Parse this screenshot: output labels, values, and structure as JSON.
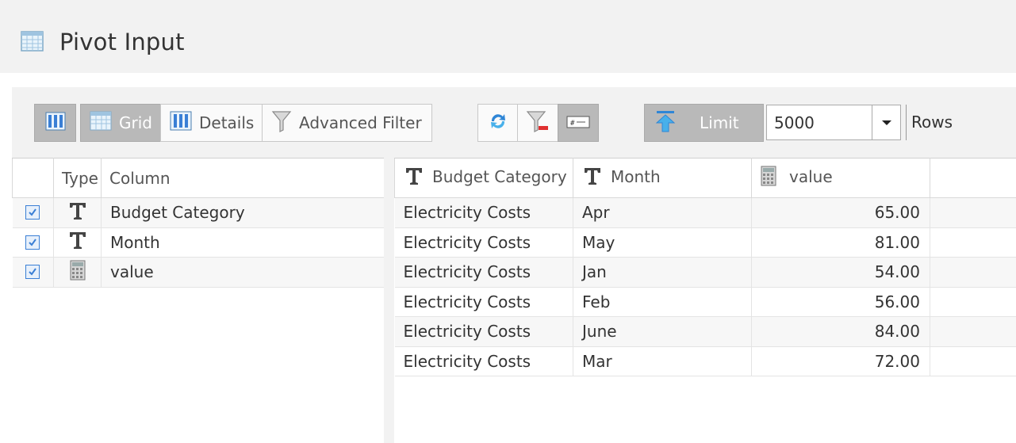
{
  "header": {
    "title": "Pivot Input",
    "icon": "table-icon"
  },
  "toolbar": {
    "layout_toggle_icon": "columns-icon",
    "view_tabs": [
      {
        "label": "Grid",
        "icon": "grid-icon",
        "active": true
      },
      {
        "label": "Details",
        "icon": "details-icon",
        "active": false
      },
      {
        "label": "Advanced Filter",
        "icon": "funnel-icon",
        "active": false
      }
    ],
    "action_icons": [
      "refresh-icon",
      "clear-filter-icon",
      "row-number-icon"
    ],
    "limit": {
      "label": "Limit",
      "value": "5000",
      "suffix": "Rows",
      "icon": "upload-arrow-icon"
    }
  },
  "columns_panel": {
    "headers": {
      "check": "",
      "type": "Type",
      "column": "Column"
    },
    "rows": [
      {
        "checked": true,
        "type": "text",
        "column": "Budget Category"
      },
      {
        "checked": true,
        "type": "text",
        "column": "Month"
      },
      {
        "checked": true,
        "type": "number",
        "column": "value"
      }
    ]
  },
  "grid": {
    "headers": [
      {
        "label": "Budget Category",
        "type": "text"
      },
      {
        "label": "Month",
        "type": "text"
      },
      {
        "label": "value",
        "type": "number"
      }
    ],
    "rows": [
      {
        "budget_category": "Electricity Costs",
        "month": "Apr",
        "value": "65.00"
      },
      {
        "budget_category": "Electricity Costs",
        "month": "May",
        "value": "81.00"
      },
      {
        "budget_category": "Electricity Costs",
        "month": "Jan",
        "value": "54.00"
      },
      {
        "budget_category": "Electricity Costs",
        "month": "Feb",
        "value": "56.00"
      },
      {
        "budget_category": "Electricity Costs",
        "month": "June",
        "value": "84.00"
      },
      {
        "budget_category": "Electricity Costs",
        "month": "Mar",
        "value": "72.00"
      }
    ]
  },
  "colors": {
    "accent_blue": "#3a7fd5",
    "active_button": "#b9b9b9",
    "panel_bg": "#f2f2f2"
  }
}
